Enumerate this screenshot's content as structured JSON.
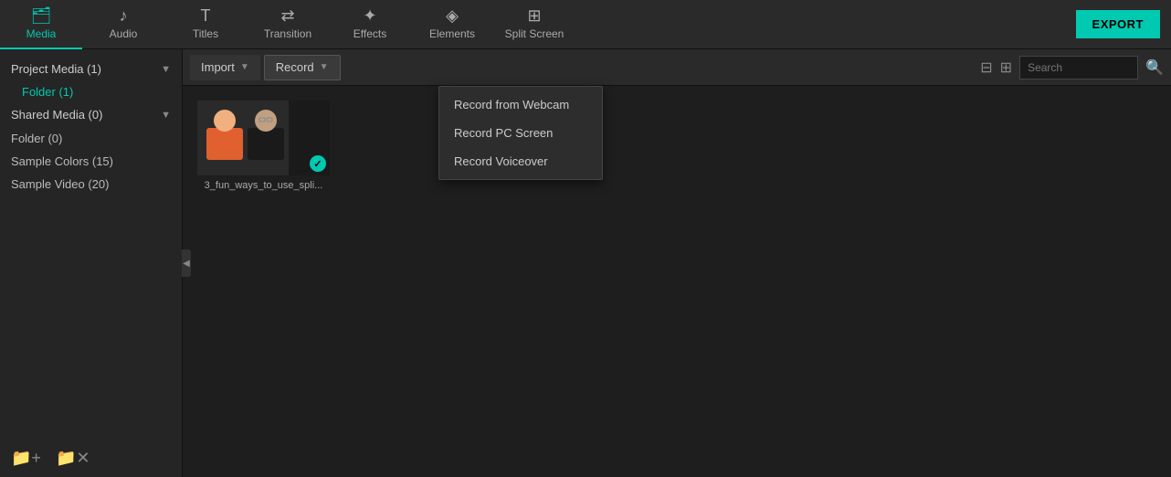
{
  "nav": {
    "items": [
      {
        "id": "media",
        "label": "Media",
        "icon": "🗂",
        "active": true
      },
      {
        "id": "audio",
        "label": "Audio",
        "icon": "♪"
      },
      {
        "id": "titles",
        "label": "Titles",
        "icon": "T"
      },
      {
        "id": "transition",
        "label": "Transition",
        "icon": "⇄"
      },
      {
        "id": "effects",
        "label": "Effects",
        "icon": "✦"
      },
      {
        "id": "elements",
        "label": "Elements",
        "icon": "◈"
      },
      {
        "id": "split-screen",
        "label": "Split Screen",
        "icon": "⊞"
      }
    ],
    "export_label": "EXPORT"
  },
  "sidebar": {
    "project_media_label": "Project Media (1)",
    "folder_label": "Folder (1)",
    "shared_media_label": "Shared Media (0)",
    "folder2_label": "Folder (0)",
    "sample_colors_label": "Sample Colors (15)",
    "sample_video_label": "Sample Video (20)"
  },
  "toolbar": {
    "import_label": "Import",
    "record_label": "Record",
    "search_placeholder": "Search"
  },
  "record_dropdown": {
    "items": [
      {
        "id": "webcam",
        "label": "Record from Webcam"
      },
      {
        "id": "screen",
        "label": "Record PC Screen"
      },
      {
        "id": "voiceover",
        "label": "Record Voiceover"
      }
    ]
  },
  "media": {
    "items": [
      {
        "id": "video1",
        "label": "3_fun_ways_to_use_spli...",
        "has_check": true
      }
    ]
  }
}
